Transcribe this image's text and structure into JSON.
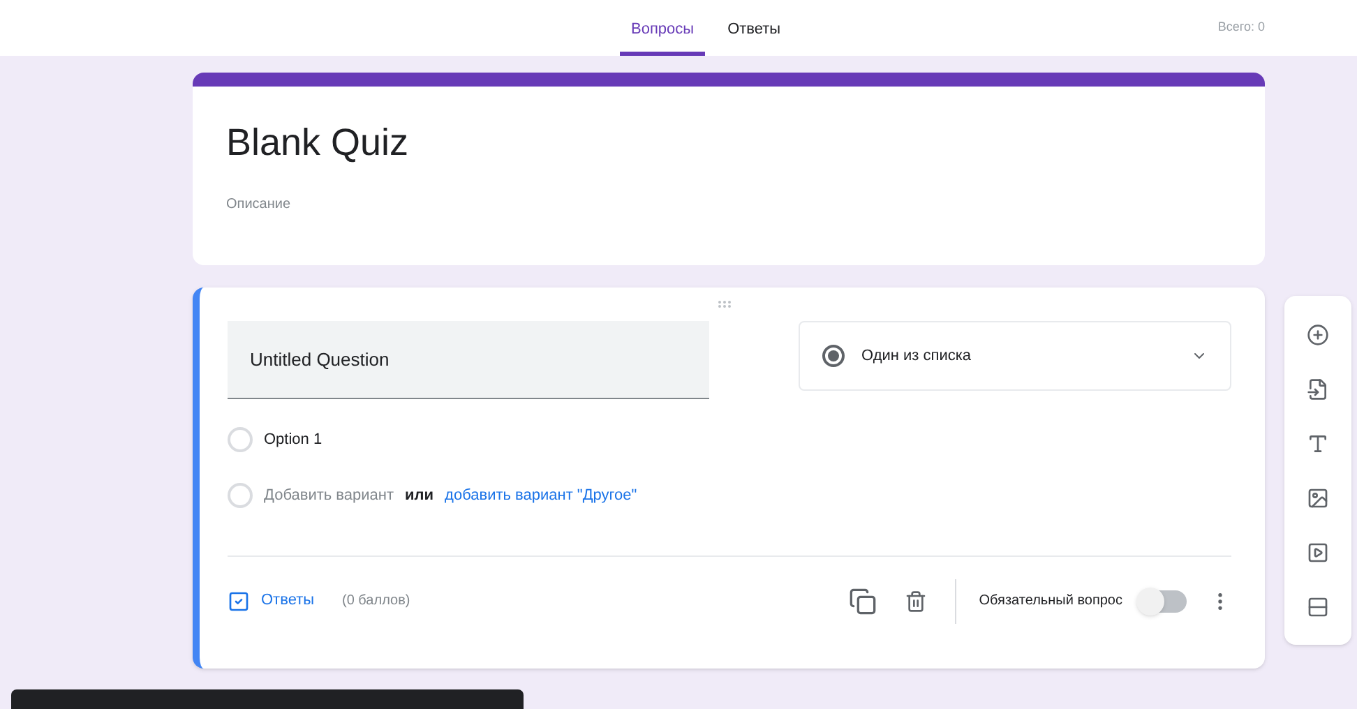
{
  "tabs": [
    {
      "label": "Вопросы",
      "selected": true
    },
    {
      "label": "Ответы",
      "selected": false
    }
  ],
  "total": "Всего: 0",
  "form": {
    "title": "Blank Quiz",
    "description": "Описание"
  },
  "question": {
    "title": "Untitled Question",
    "type": "Один из списка",
    "options": [
      {
        "label": "Option 1",
        "selected": false
      }
    ],
    "add_option": "Добавить вариант",
    "or": "или",
    "add_other": "добавить вариант \"Другое\"",
    "answers_label": "Ответы",
    "points": "(0 баллов)",
    "required_label": "Обязательный вопрос",
    "required": false
  }
}
